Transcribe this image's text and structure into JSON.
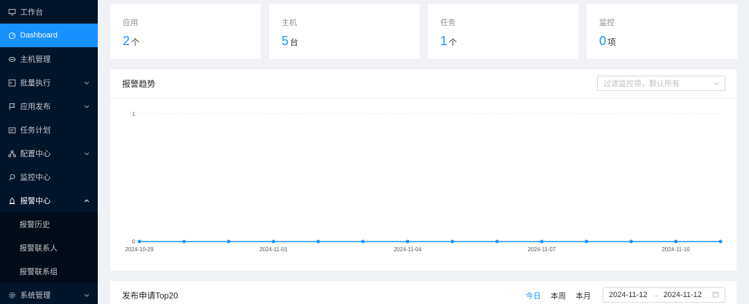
{
  "sidebar": {
    "items": [
      {
        "label": "工作台",
        "icon": "desktop-icon"
      },
      {
        "label": "Dashboard",
        "icon": "dashboard-icon",
        "active": true
      },
      {
        "label": "主机管理",
        "icon": "cloud-server-icon"
      },
      {
        "label": "批量执行",
        "icon": "code-icon",
        "arrow": "∨"
      },
      {
        "label": "应用发布",
        "icon": "flag-icon",
        "arrow": "∨"
      },
      {
        "label": "任务计划",
        "icon": "schedule-icon"
      },
      {
        "label": "配置中心",
        "icon": "cluster-icon",
        "arrow": "∨"
      },
      {
        "label": "监控中心",
        "icon": "monitor-icon"
      },
      {
        "label": "报警中心",
        "icon": "alert-icon",
        "arrow": "∧"
      },
      {
        "label": "系统管理",
        "icon": "setting-icon",
        "arrow": "∨"
      }
    ],
    "alarm_submenu": [
      "报警历史",
      "报警联系人",
      "报警联系组"
    ]
  },
  "stats": [
    {
      "title": "应用",
      "value": "2",
      "unit": "个"
    },
    {
      "title": "主机",
      "value": "5",
      "unit": "台"
    },
    {
      "title": "任务",
      "value": "1",
      "unit": "个"
    },
    {
      "title": "监控",
      "value": "0",
      "unit": "项"
    }
  ],
  "trend": {
    "title": "报警趋势",
    "filter_placeholder": "过滤监控项，默认所有"
  },
  "chart_data": {
    "type": "line",
    "x": [
      "2024-10-29",
      "2024-10-30",
      "2024-10-31",
      "2024-11-01",
      "2024-11-02",
      "2024-11-03",
      "2024-11-04",
      "2024-11-05",
      "2024-11-06",
      "2024-11-07",
      "2024-11-08",
      "2024-11-09",
      "2024-11-10",
      "2024-11-11"
    ],
    "x_tick_labels": [
      "2024-10-29",
      "2024-11-01",
      "2024-11-04",
      "2024-11-07",
      "2024-11-10"
    ],
    "series": [
      {
        "values": [
          0,
          0,
          0,
          0,
          0,
          0,
          0,
          0,
          0,
          0,
          0,
          0,
          0,
          0
        ]
      }
    ],
    "y_ticks": [
      0,
      1
    ],
    "ylim": [
      0,
      1
    ],
    "grid": true,
    "color": "#1890ff"
  },
  "deploy": {
    "title": "发布申请Top20",
    "ranges": [
      "今日",
      "本周",
      "本月"
    ],
    "active_range": "今日",
    "date_start": "2024-11-12",
    "date_sep": "→",
    "date_end": "2024-11-12"
  }
}
